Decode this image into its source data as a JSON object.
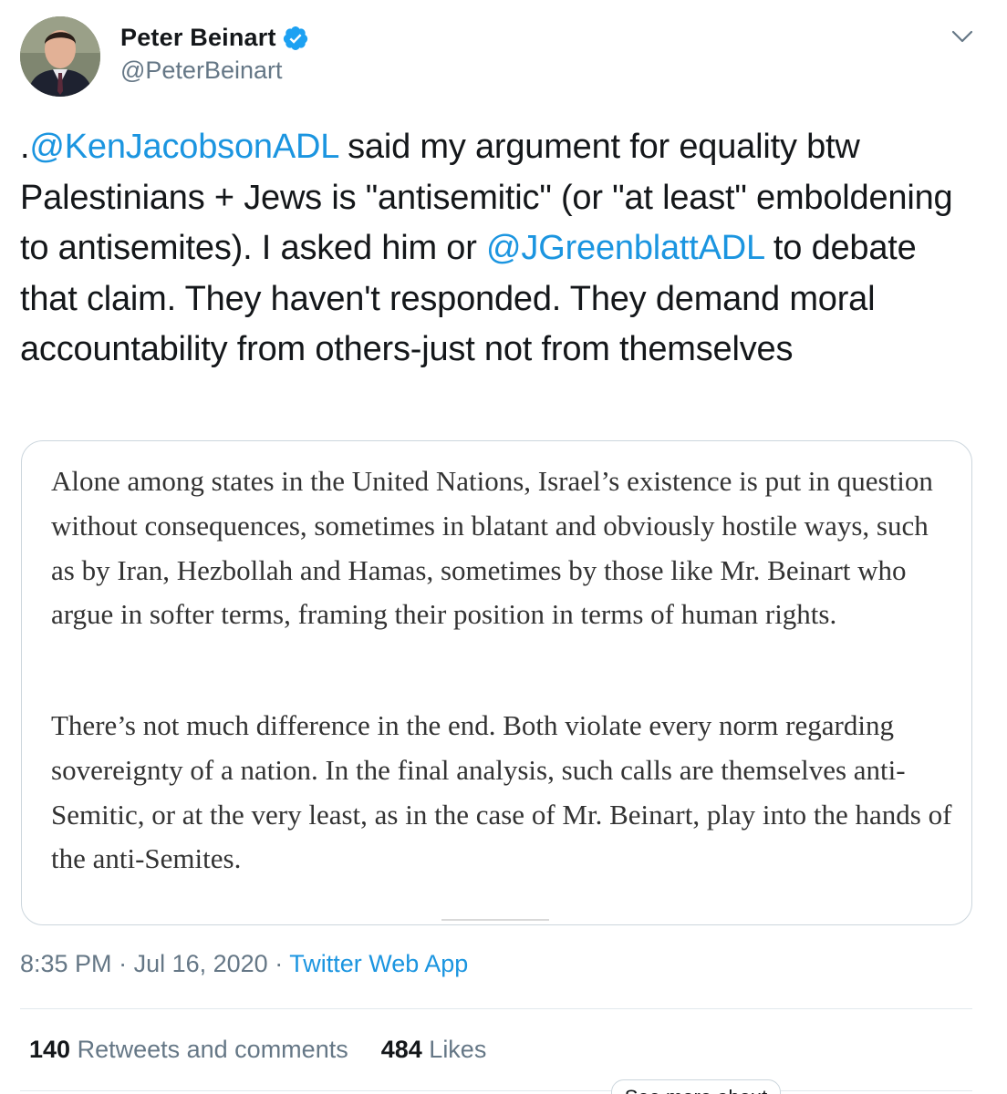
{
  "author": {
    "display_name": "Peter Beinart",
    "handle": "@PeterBeinart",
    "verified": true,
    "avatar_icon": "profile-photo"
  },
  "tweet": {
    "segments": [
      {
        "text": ".",
        "type": "text"
      },
      {
        "text": "@KenJacobsonADL",
        "type": "mention"
      },
      {
        "text": " said my argument for equality btw Palestinians + Jews is \"antisemitic\" (or \"at least\" emboldening to antisemites). I asked him or ",
        "type": "text"
      },
      {
        "text": "@JGreenblattADL",
        "type": "mention"
      },
      {
        "text": " to debate that claim. They haven't responded. They demand moral accountability from others-just not from themselves",
        "type": "text"
      }
    ]
  },
  "quote_image": {
    "paragraph_1": "Alone among states in the United Nations, Israel’s existence is put in question without consequences, sometimes in blatant and obviously hostile ways, such as by Iran, Hezbollah and Hamas, sometimes by those like Mr. Beinart who argue in softer terms, framing their position in terms of human rights.",
    "paragraph_2": "There’s not much difference in the end. Both violate every norm regarding sovereignty of a nation. In the final analysis, such calls are themselves anti-Semitic, or at the very least, as in the case of Mr. Beinart, play into the hands of the anti-Semites."
  },
  "meta": {
    "time": "8:35 PM",
    "separator": " · ",
    "date": "Jul 16, 2020",
    "source": "Twitter Web App"
  },
  "stats": {
    "retweets_count": "140",
    "retweets_label": "Retweets and comments",
    "likes_count": "484",
    "likes_label": "Likes"
  },
  "overlay": {
    "label": "See more about"
  },
  "colors": {
    "link": "#1b95e0",
    "verified": "#1da1f2",
    "secondary_text": "#657786",
    "border": "#ccd6dd"
  }
}
